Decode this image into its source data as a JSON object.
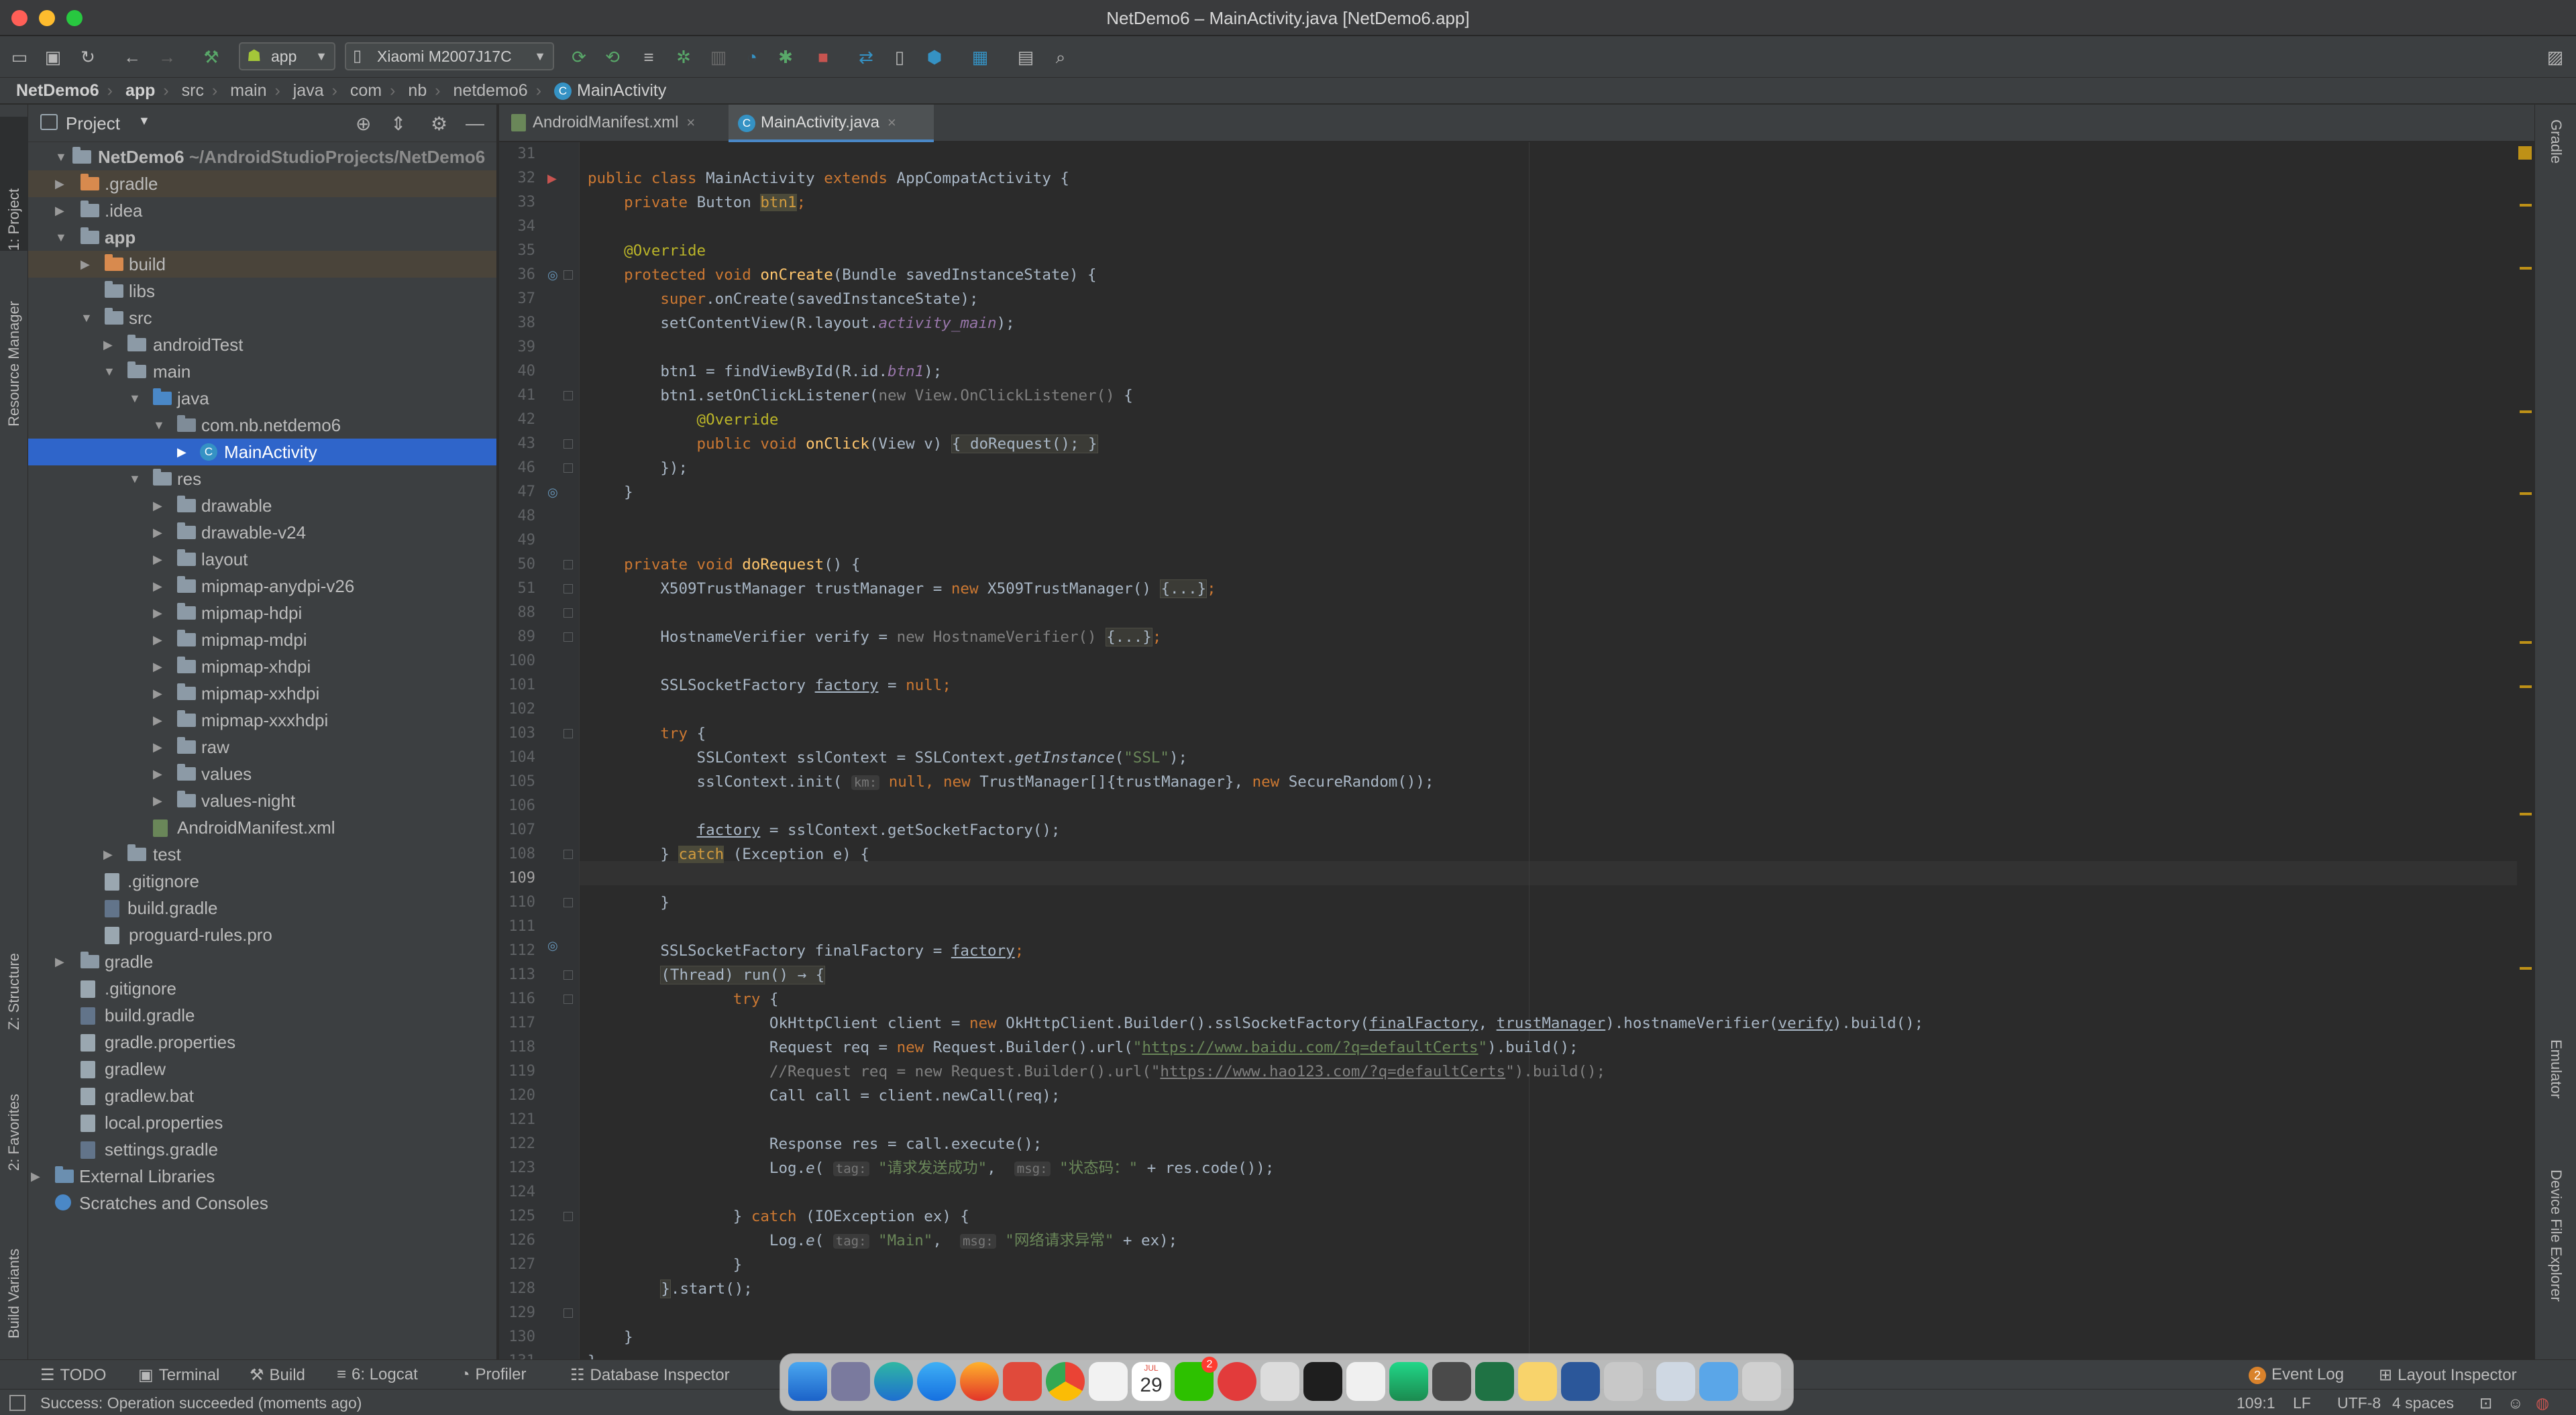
{
  "window": {
    "title": "NetDemo6 – MainActivity.java [NetDemo6.app]"
  },
  "toolbar": {
    "run_config": "app",
    "device": "Xiaomi M2007J17C"
  },
  "breadcrumb": [
    "NetDemo6",
    "app",
    "src",
    "main",
    "java",
    "com",
    "nb",
    "netdemo6",
    "MainActivity"
  ],
  "left_stripe": [
    "1: Project",
    "Resource Manager",
    "Z: Structure",
    "2: Favorites",
    "Build Variants"
  ],
  "right_stripe": [
    "Gradle",
    "Emulator",
    "Device File Explorer"
  ],
  "project_panel": {
    "title": "Project",
    "tree": [
      {
        "label": "NetDemo6",
        "extra": "~/AndroidStudioProjects/NetDemo6"
      },
      {
        "label": ".gradle"
      },
      {
        "label": ".idea"
      },
      {
        "label": "app"
      },
      {
        "label": "build"
      },
      {
        "label": "libs"
      },
      {
        "label": "src"
      },
      {
        "label": "androidTest"
      },
      {
        "label": "main"
      },
      {
        "label": "java"
      },
      {
        "label": "com.nb.netdemo6"
      },
      {
        "label": "MainActivity"
      },
      {
        "label": "res"
      },
      {
        "label": "drawable"
      },
      {
        "label": "drawable-v24"
      },
      {
        "label": "layout"
      },
      {
        "label": "mipmap-anydpi-v26"
      },
      {
        "label": "mipmap-hdpi"
      },
      {
        "label": "mipmap-mdpi"
      },
      {
        "label": "mipmap-xhdpi"
      },
      {
        "label": "mipmap-xxhdpi"
      },
      {
        "label": "mipmap-xxxhdpi"
      },
      {
        "label": "raw"
      },
      {
        "label": "values"
      },
      {
        "label": "values-night"
      },
      {
        "label": "AndroidManifest.xml"
      },
      {
        "label": "test"
      },
      {
        "label": ".gitignore"
      },
      {
        "label": "build.gradle"
      },
      {
        "label": "proguard-rules.pro"
      },
      {
        "label": "gradle"
      },
      {
        "label": ".gitignore"
      },
      {
        "label": "build.gradle"
      },
      {
        "label": "gradle.properties"
      },
      {
        "label": "gradlew"
      },
      {
        "label": "gradlew.bat"
      },
      {
        "label": "local.properties"
      },
      {
        "label": "settings.gradle"
      },
      {
        "label": "External Libraries"
      },
      {
        "label": "Scratches and Consoles"
      }
    ]
  },
  "editor_tabs": [
    "AndroidManifest.xml",
    "MainActivity.java"
  ],
  "editor": {
    "line_numbers": [
      "31",
      "32",
      "33",
      "34",
      "35",
      "36",
      "37",
      "38",
      "39",
      "40",
      "41",
      "42",
      "43",
      "46",
      "47",
      "48",
      "49",
      "50",
      "51",
      "88",
      "89",
      "100",
      "101",
      "102",
      "103",
      "104",
      "105",
      "106",
      "107",
      "108",
      "109",
      "110",
      "111",
      "112",
      "113",
      "116",
      "117",
      "118",
      "119",
      "120",
      "121",
      "122",
      "123",
      "124",
      "125",
      "126",
      "127",
      "128",
      "129",
      "130",
      "131"
    ],
    "cursor_line": "109",
    "code_tokens": {
      "l32_public": "public class ",
      "l32_name": "MainActivity ",
      "l32_ext": "extends ",
      "l32_base": "AppCompatActivity {",
      "l33_a": "    private ",
      "l33_b": "Button ",
      "l33_c": "btn1",
      "l33_d": ";",
      "l35": "    @Override",
      "l36_a": "    protected void ",
      "l36_b": "onCreate",
      "l36_c": "(Bundle savedInstanceState) {",
      "l37_a": "        ",
      "l37_b": "super",
      "l37_c": ".onCreate(savedInstanceState);",
      "l38_a": "        setContentView(R.layout.",
      "l38_b": "activity_main",
      "l38_c": ");",
      "l40_a": "        btn1 = findViewById(R.id.",
      "l40_b": "btn1",
      "l40_c": ");",
      "l41_a": "        btn1.setOnClickListener(",
      "l41_b": "new View.OnClickListener() ",
      "l41_c": "{",
      "l42": "            @Override",
      "l43_a": "            public void ",
      "l43_b": "onClick",
      "l43_c": "(View v) ",
      "l43_d": "{ doRequest(); }",
      "l46": "        });",
      "l47": "    }",
      "l50_a": "    private void ",
      "l50_b": "doRequest",
      "l50_c": "() {",
      "l51_a": "        X509TrustManager trustManager = ",
      "l51_b": "new ",
      "l51_c": "X509TrustManager() ",
      "l51_d": "{...}",
      "l51_e": ";",
      "l89_a": "        HostnameVerifier verify = ",
      "l89_b": "new HostnameVerifier() ",
      "l89_c": "{...}",
      "l89_d": ";",
      "l101_a": "        SSLSocketFactory ",
      "l101_b": "factory",
      "l101_c": " = ",
      "l101_d": "null",
      "l101_e": ";",
      "l103_a": "        ",
      "l103_b": "try ",
      "l103_c": "{",
      "l104_a": "            SSLContext sslContext = SSLContext.",
      "l104_b": "getInstance",
      "l104_c": "(",
      "l104_d": "\"SSL\"",
      "l104_e": ");",
      "l105_a": "            sslContext.init( ",
      "l105_b": "km:",
      "l105_c": " null",
      "l105_d": ", ",
      "l105_e": "new ",
      "l105_f": "TrustManager[]{trustManager}, ",
      "l105_g": "new ",
      "l105_h": "SecureRandom());",
      "l107_a": "            ",
      "l107_b": "factory",
      "l107_c": " = sslContext.getSocketFactory();",
      "l108_a": "        } ",
      "l108_b": "catch",
      "l108_c": " (Exception e) {",
      "l110": "        }",
      "l112_a": "        SSLSocketFactory finalFactory = ",
      "l112_b": "factory",
      "l112_c": ";",
      "l113_a": "        ",
      "l113_b": "(Thread) run() → {",
      "l116_a": "                ",
      "l116_b": "try ",
      "l116_c": "{",
      "l117_a": "                    OkHttpClient client = ",
      "l117_b": "new ",
      "l117_c": "OkHttpClient.Builder().sslSocketFactory(",
      "l117_d": "finalFactory",
      "l117_e": ", ",
      "l117_f": "trustManager",
      "l117_g": ").hostnameVerifier(",
      "l117_h": "verify",
      "l117_i": ").build();",
      "l118_a": "                    Request req = ",
      "l118_b": "new ",
      "l118_c": "Request.Builder().url(",
      "l118_d": "\"",
      "l118_e": "https://www.baidu.com/?q=defaultCerts",
      "l118_f": "\"",
      "l118_g": ").build();",
      "l119_a": "                    //Request req = new Request.Builder().url(\"",
      "l119_b": "https://www.hao123.com/?q=defaultCerts",
      "l119_c": "\").build();",
      "l120": "                    Call call = client.newCall(req);",
      "l122": "                    Response res = call.execute();",
      "l123_a": "                    Log.",
      "l123_b": "e",
      "l123_c": "( ",
      "l123_d": "tag:",
      "l123_e": " \"请求发送成功\"",
      "l123_f": ",  ",
      "l123_g": "msg:",
      "l123_h": " \"状态码：\"",
      "l123_i": " + res.code());",
      "l125_a": "                } ",
      "l125_b": "catch",
      "l125_c": " (IOException ex) {",
      "l126_a": "                    Log.",
      "l126_b": "e",
      "l126_c": "( ",
      "l126_d": "tag:",
      "l126_e": " \"Main\"",
      "l126_f": ",  ",
      "l126_g": "msg:",
      "l126_h": " \"网络请求异常\"",
      "l126_i": " + ex);",
      "l127": "                }",
      "l128_a": "        ",
      "l128_b": "}",
      "l128_c": ".start();",
      "l130": "    }",
      "l131": "}"
    }
  },
  "bottom_tools": [
    "TODO",
    "Terminal",
    "Build",
    "6: Logcat",
    "Profiler",
    "Database Inspector",
    "Event Log",
    "Layout Inspector"
  ],
  "event_log_count": "2",
  "status_bar": {
    "message": "Success: Operation succeeded (moments ago)",
    "position": "109:1",
    "line_sep": "LF",
    "encoding": "UTF-8",
    "indent": "4 spaces"
  },
  "dock": {
    "calendar_day": "29",
    "calendar_month": "JUL",
    "wechat_badge": "2"
  },
  "colors": {
    "editor_bg": "#2b2b2b",
    "panel_bg": "#3c3f41",
    "selection": "#2f65ca",
    "keyword": "#cc7832",
    "string": "#6a8759",
    "method": "#ffc66d",
    "annotation": "#bbb529"
  }
}
